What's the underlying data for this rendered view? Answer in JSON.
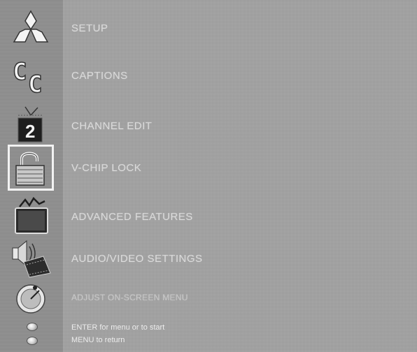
{
  "menu": {
    "items": [
      {
        "label": "SETUP",
        "icon": "mitsubishi-logo-icon"
      },
      {
        "label": "CAPTIONS",
        "icon": "closed-caption-icon"
      },
      {
        "label": "CHANNEL EDIT",
        "icon": "channel-number-icon",
        "channel_number": "2"
      },
      {
        "label": "V-CHIP LOCK",
        "icon": "padlock-icon",
        "selected": true
      },
      {
        "label": "ADVANCED FEATURES",
        "icon": "tv-screen-icon"
      },
      {
        "label": "AUDIO/VIDEO SETTINGS",
        "icon": "speaker-film-icon"
      },
      {
        "label": "ADJUST ON-SCREEN MENU",
        "icon": "round-dial-icon"
      }
    ]
  },
  "instructions": {
    "line1": "ENTER for menu or to start",
    "line2": "MENU to return"
  },
  "colors": {
    "background": "#a3a3a3",
    "icon_column": "#8f8f8f",
    "selection_border": "#f2f2f2",
    "label_text": "#d8d8d8"
  }
}
